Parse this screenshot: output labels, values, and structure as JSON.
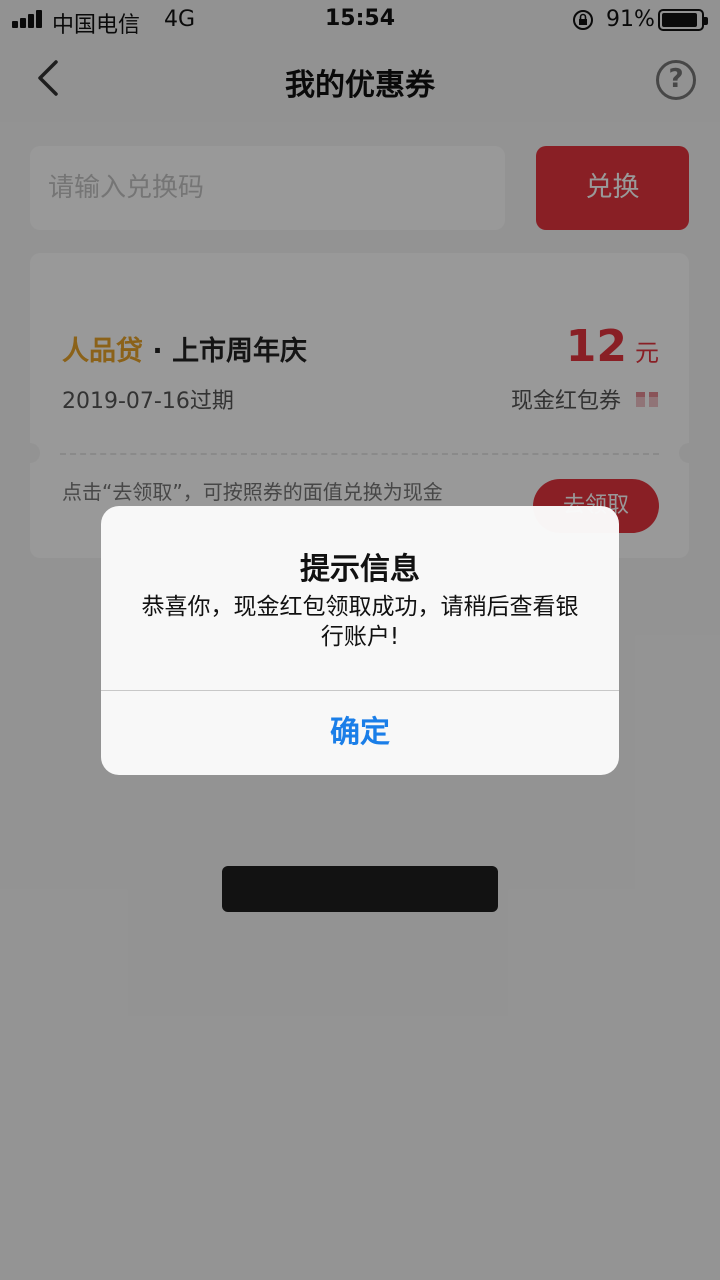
{
  "status_bar": {
    "carrier": "中国电信",
    "network": "4G",
    "time": "15:54",
    "battery_percent": "91%",
    "battery_level": 0.91
  },
  "nav": {
    "title": "我的优惠券",
    "back_icon": "chevron-left-icon",
    "help_icon": "question-circle-icon",
    "help_glyph": "?"
  },
  "redeem": {
    "placeholder": "请输入兑换码",
    "value": "",
    "button_label": "兑换"
  },
  "coupons": [
    {
      "brand": "人品贷",
      "separator": " · ",
      "name": "上市周年庆",
      "amount": "12",
      "unit": "元",
      "expire": "2019-07-16过期",
      "type": "现金红包券",
      "note": "点击“去领取”，可按照券的面值兑换为现金",
      "claim_label": "去领取"
    }
  ],
  "alert": {
    "title": "提示信息",
    "message": "恭喜你，现金红包领取成功，请稍后查看银行账户!",
    "confirm_label": "确定"
  },
  "colors": {
    "accent_red": "#e4353f",
    "brand_gold": "#e8a32a",
    "alert_button_blue": "#1a7ee8",
    "overlay": "rgba(0,0,0,0.4)"
  }
}
